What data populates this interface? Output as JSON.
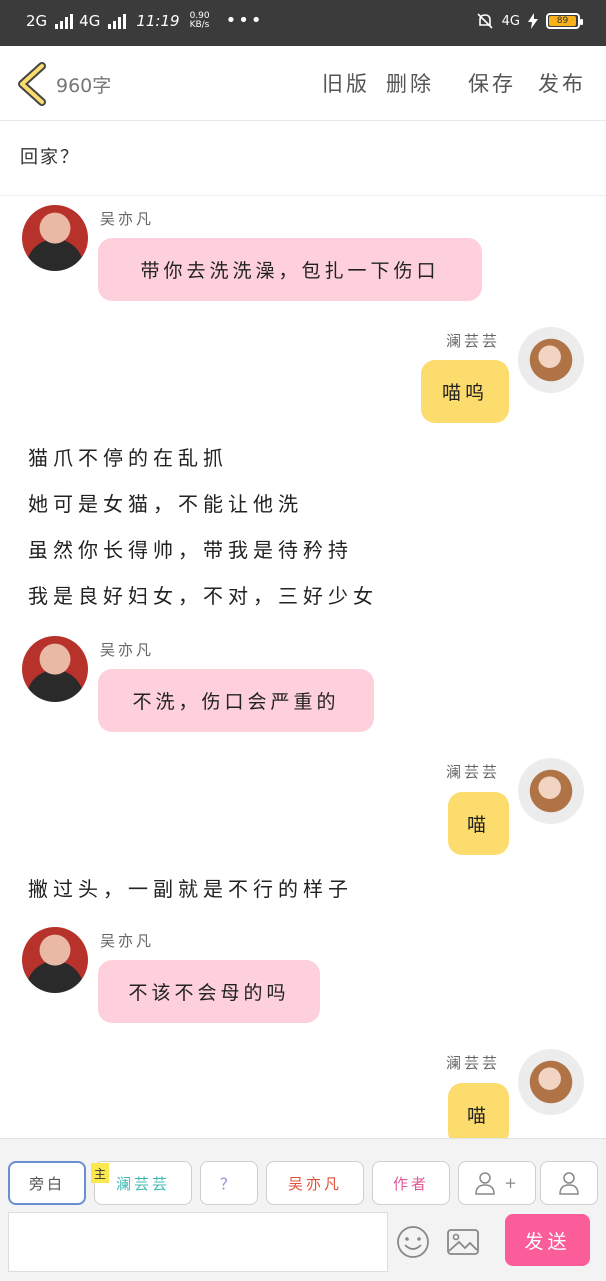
{
  "status_bar": {
    "network1": "2G",
    "network2": "4G",
    "time": "11:19",
    "speed_value": "0.90",
    "speed_unit": "KB/s",
    "dots": "•••",
    "lte": "4G",
    "battery": "89"
  },
  "nav": {
    "word_count": "960字",
    "old_version": "旧版",
    "delete": "删除",
    "save": "保存",
    "publish": "发布"
  },
  "chapter_title": "回家？",
  "chat": [
    {
      "type": "left",
      "name": "吴亦凡",
      "text": "带你去洗洗澡，包扎一下伤口"
    },
    {
      "type": "right",
      "name": "澜芸芸",
      "text": "喵呜"
    },
    {
      "type": "narration",
      "lines": [
        "猫爪不停的在乱抓",
        "她可是女猫，不能让他洗",
        "虽然你长得帅，带我是待矜持",
        "我是良好妇女，不对，三好少女"
      ]
    },
    {
      "type": "left",
      "name": "吴亦凡",
      "text": "不洗，伤口会严重的"
    },
    {
      "type": "right",
      "name": "澜芸芸",
      "text": "喵"
    },
    {
      "type": "narration",
      "lines": [
        "撇过头，一副就是不行的样子"
      ]
    },
    {
      "type": "left",
      "name": "吴亦凡",
      "text": "不该不会母的吗"
    },
    {
      "type": "right",
      "name": "澜芸芸",
      "text": "喵"
    }
  ],
  "toolbar": {
    "chips": [
      "旁白",
      "澜芸芸",
      "？",
      "吴亦凡",
      "作者",
      "+"
    ],
    "main_badge": "主",
    "input_placeholder": "",
    "send": "发送"
  },
  "colors": {
    "left_bubble": "#fdd0dc",
    "right_bubble": "#fcdc6c",
    "send": "#fb5d9a",
    "chip_lanyunyun": "#3fb8b2",
    "chip_question": "#9a86d6",
    "chip_wuyifan": "#e0513d",
    "chip_author": "#e05a9a"
  }
}
